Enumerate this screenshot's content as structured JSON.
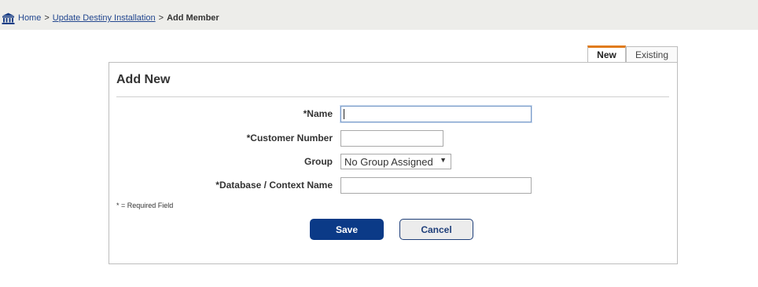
{
  "breadcrumb": {
    "home": "Home",
    "separator": ">",
    "parent": "Update Destiny Installation",
    "current": "Add Member"
  },
  "tabs": {
    "new": "New",
    "existing": "Existing",
    "active": "New"
  },
  "form": {
    "title": "Add New",
    "name_label": "*Name",
    "name_value": "",
    "customer_number_label": "*Customer Number",
    "customer_number_value": "",
    "group_label": "Group",
    "group_selected": "No Group Assigned",
    "database_label": "*Database / Context Name",
    "database_value": "",
    "required_note": "* = Required Field"
  },
  "buttons": {
    "save": "Save",
    "cancel": "Cancel"
  },
  "colors": {
    "accent_tab": "#e07b1a",
    "primary_button": "#0b3a87",
    "link": "#23478f",
    "topbar": "#ededea"
  },
  "icons": {
    "home": "library-building-icon",
    "dropdown": "triangle-down-icon"
  }
}
